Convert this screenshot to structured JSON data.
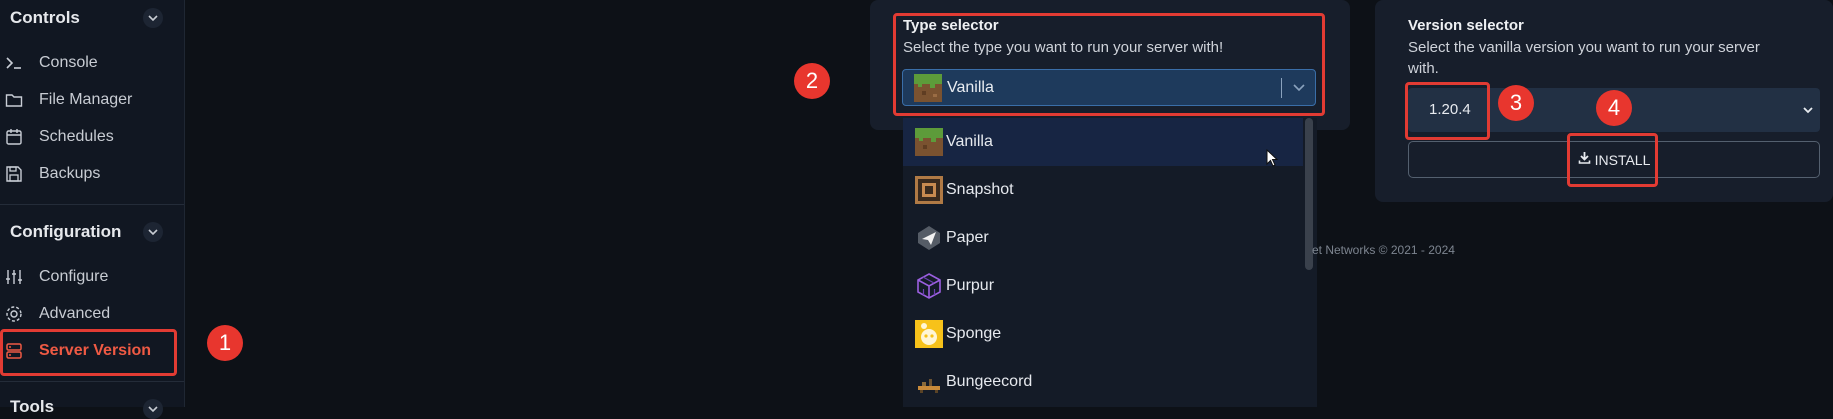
{
  "sidebar": {
    "controls_heading": "Controls",
    "controls_items": [
      {
        "label": "Console",
        "icon": "terminal-icon"
      },
      {
        "label": "File Manager",
        "icon": "folder-icon"
      },
      {
        "label": "Schedules",
        "icon": "calendar-icon"
      },
      {
        "label": "Backups",
        "icon": "save-icon"
      }
    ],
    "configuration_heading": "Configuration",
    "configuration_items": [
      {
        "label": "Configure",
        "icon": "sliders-icon"
      },
      {
        "label": "Advanced",
        "icon": "gear-icon"
      },
      {
        "label": "Server Version",
        "icon": "server-icon",
        "active": true
      }
    ],
    "tools_heading": "Tools"
  },
  "annotations": [
    "1",
    "2",
    "3",
    "4"
  ],
  "type_selector": {
    "title": "Type selector",
    "description": "Select the type you want to run your server with!",
    "selected": "Vanilla",
    "options": [
      "Vanilla",
      "Snapshot",
      "Paper",
      "Purpur",
      "Sponge",
      "Bungeecord"
    ]
  },
  "version_selector": {
    "title": "Version selector",
    "description_line1": "Select the vanilla version you want to run your server",
    "description_line2": "with.",
    "selected": "1.20.4",
    "install_label": "INSTALL"
  },
  "footer": {
    "text": "et Networks © 2021 - 2024"
  },
  "colors": {
    "accent": "#ef5a44",
    "annotation": "#e8362e",
    "background": "#0d1117",
    "card": "#171e2b"
  }
}
